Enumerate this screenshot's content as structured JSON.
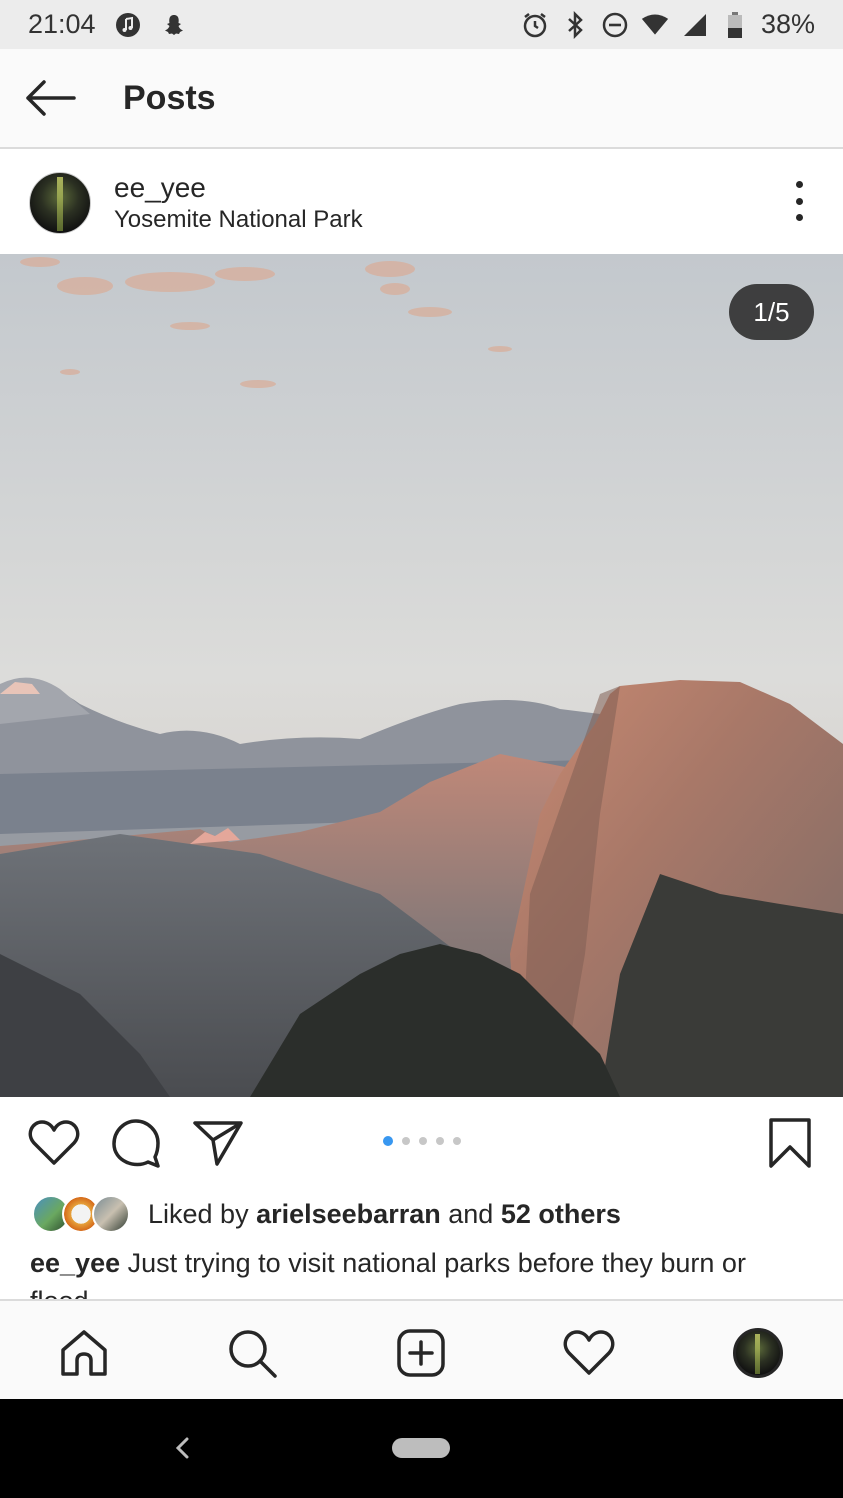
{
  "status_bar": {
    "time": "21:04",
    "battery": "38%",
    "icons": [
      "music-icon",
      "snapchat-icon",
      "alarm-icon",
      "bluetooth-icon",
      "do-not-disturb-icon",
      "wifi-icon",
      "cell-signal-icon",
      "battery-icon"
    ]
  },
  "header": {
    "title": "Posts",
    "back_icon": "back-arrow-icon"
  },
  "post": {
    "username": "ee_yee",
    "location": "Yosemite National Park",
    "image_counter": "1/5",
    "carousel": {
      "count": 5,
      "active_index": 0,
      "active_color": "#3897f0"
    }
  },
  "actions": {
    "icons": [
      "heart-icon",
      "comment-icon",
      "share-icon",
      "bookmark-icon"
    ]
  },
  "likes": {
    "prefix": "Liked by",
    "user": "arielseebarran",
    "conjunction": "and",
    "others": "52 others"
  },
  "caption": {
    "username": "ee_yee",
    "text": "Just trying to visit national parks before they burn or flood"
  },
  "bottom_nav": {
    "items": [
      "home-icon",
      "search-icon",
      "new-post-icon",
      "activity-icon",
      "profile-avatar"
    ]
  },
  "system_nav": {
    "items": [
      "back-icon",
      "home-pill"
    ]
  }
}
